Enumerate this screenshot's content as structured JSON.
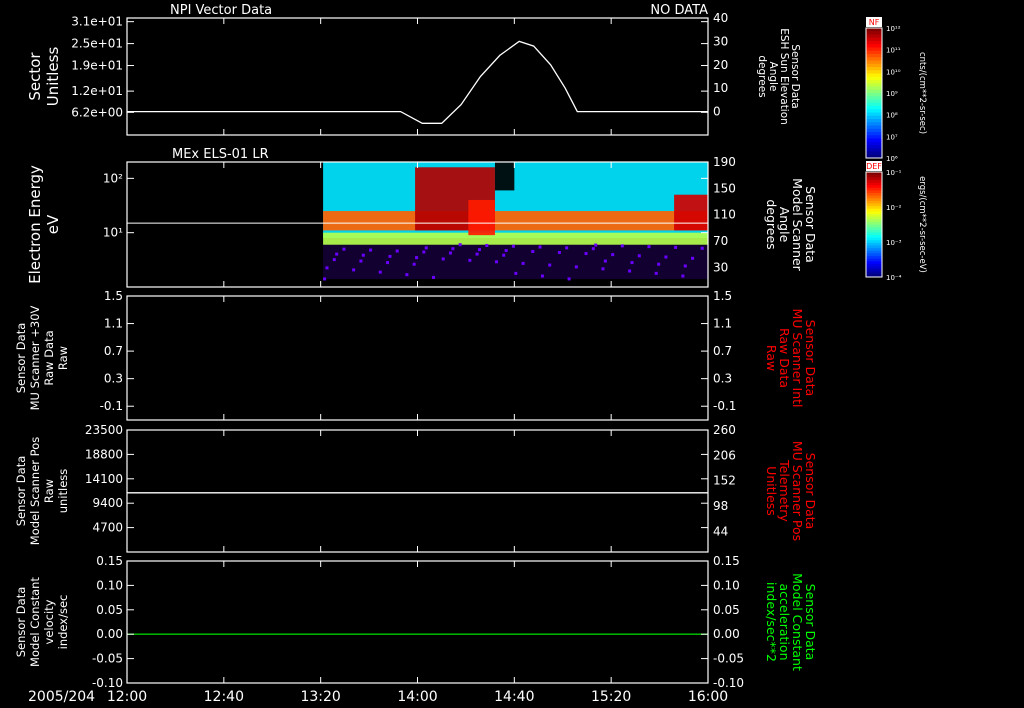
{
  "header": {
    "title": "NPI Vector Data",
    "status": "NO DATA"
  },
  "time_axis": {
    "date": "2005/204",
    "ticks": [
      "12:00",
      "12:40",
      "13:20",
      "14:00",
      "14:40",
      "15:20",
      "16:00"
    ],
    "tick_minutes": [
      720,
      760,
      800,
      840,
      880,
      920,
      960
    ],
    "range_minutes": [
      720,
      960
    ]
  },
  "colors": {
    "background": "#000000",
    "axis": "#ffffff",
    "trace": "#ffffff",
    "red_label": "#ff0000",
    "green_label": "#00ff00",
    "green_trace": "#00cc00"
  },
  "colorbars": [
    {
      "title": "NF",
      "label": "cnts/(cm**2-sr-sec)",
      "ticks": [
        "10¹²",
        "10¹¹",
        "10¹⁰",
        "10⁹",
        "10⁸",
        "10⁷",
        "10⁶"
      ]
    },
    {
      "title": "DEF",
      "label": "ergs/(cm**2-sr-sec-eV)",
      "ticks": [
        "10⁻¹",
        "10⁻²",
        "10⁻³",
        "10⁻⁴"
      ]
    }
  ],
  "chart_data": [
    {
      "type": "line",
      "left_label": [
        "Sector",
        "Unitless"
      ],
      "left_ticks": [
        "3.1e+01",
        "2.5e+01",
        "1.9e+01",
        "1.2e+01",
        "6.2e+00"
      ],
      "left_tick_values": [
        31,
        25,
        19,
        12,
        6.2
      ],
      "left_range": [
        0,
        32
      ],
      "right_label": [
        "Sensor Data",
        "ESH Sun Elevation",
        "Angle",
        "degrees"
      ],
      "right_label_color": "#ffffff",
      "right_ticks": [
        "40",
        "30",
        "20",
        "10",
        "0"
      ],
      "right_tick_values": [
        40,
        30,
        20,
        10,
        0
      ],
      "right_range": [
        -10,
        40
      ],
      "series": [
        {
          "axis": "right",
          "color": "#ffffff",
          "x": [
            720,
            810,
            833,
            842,
            850,
            858,
            866,
            874,
            882,
            888,
            895,
            901,
            906,
            911,
            918,
            960
          ],
          "y": [
            0,
            0,
            0,
            -5,
            -5,
            3,
            15,
            24,
            30,
            28,
            20,
            10,
            0,
            0,
            0,
            0
          ]
        }
      ]
    },
    {
      "type": "heatmap",
      "title": "MEx ELS-01 LR",
      "left_label": [
        "Electron Energy",
        "eV"
      ],
      "left_ticks": [
        "10²",
        "10¹"
      ],
      "left_tick_values": [
        100,
        10
      ],
      "left_log": true,
      "left_range": [
        1,
        200
      ],
      "right_label": [
        "Sensor Data",
        "Model Scanner",
        "Angle",
        "degrees"
      ],
      "right_label_color": "#ffffff",
      "right_ticks": [
        "190",
        "150",
        "110",
        "70",
        "30"
      ],
      "right_tick_values": [
        190,
        150,
        110,
        70,
        30
      ],
      "right_range": [
        0,
        190
      ],
      "data_start_minute": 801,
      "line_value": 15,
      "bands": [
        {
          "x": [
            801,
            960
          ],
          "y": [
            8,
            200
          ],
          "level": 0.35
        },
        {
          "x": [
            801,
            960
          ],
          "y": [
            11,
            25
          ],
          "level": 0.78
        },
        {
          "x": [
            801,
            960
          ],
          "y": [
            6,
            10
          ],
          "level": 0.55
        },
        {
          "x": [
            839,
            872
          ],
          "y": [
            11,
            160
          ],
          "level": 0.95
        },
        {
          "x": [
            861,
            872
          ],
          "y": [
            9,
            40
          ],
          "level": 0.85
        },
        {
          "x": [
            872,
            880
          ],
          "y": [
            60,
            200
          ],
          "level": 0.0
        },
        {
          "x": [
            946,
            960
          ],
          "y": [
            11,
            50
          ],
          "level": 0.92
        }
      ]
    },
    {
      "type": "line",
      "left_label": [
        "Sensor Data",
        "MU Scanner +30V",
        "Raw Data",
        "Raw"
      ],
      "left_ticks": [
        "1.5",
        "1.1",
        "0.7",
        "0.3",
        "-0.1"
      ],
      "left_tick_values": [
        1.5,
        1.1,
        0.7,
        0.3,
        -0.1
      ],
      "left_range": [
        -0.3,
        1.5
      ],
      "right_label": [
        "Sensor Data",
        "MU Scanner Intl",
        "Raw Data",
        "Raw"
      ],
      "right_label_color": "#ff0000",
      "right_ticks": [
        "1.5",
        "1.1",
        "0.7",
        "0.3",
        "-0.1"
      ],
      "right_tick_values": [
        1.5,
        1.1,
        0.7,
        0.3,
        -0.1
      ],
      "right_range": [
        -0.3,
        1.5
      ],
      "series": []
    },
    {
      "type": "line",
      "left_label": [
        "Sensor Data",
        "Model Scanner Pos",
        "Raw",
        "unitless"
      ],
      "left_ticks": [
        "23500",
        "18800",
        "14100",
        "9400",
        "4700"
      ],
      "left_tick_values": [
        23500,
        18800,
        14100,
        9400,
        4700
      ],
      "left_range": [
        0,
        23500
      ],
      "right_label": [
        "Sensor Data",
        "MU Scanner Pos",
        "Telemetry",
        "Unitless"
      ],
      "right_label_color": "#ff0000",
      "right_ticks": [
        "260",
        "206",
        "152",
        "98",
        "44"
      ],
      "right_tick_values": [
        260,
        206,
        152,
        98,
        44
      ],
      "right_range": [
        0,
        260
      ],
      "series": [
        {
          "axis": "left",
          "color": "#ffffff",
          "x": [
            720,
            960
          ],
          "y": [
            11400,
            11400
          ]
        }
      ]
    },
    {
      "type": "line",
      "left_label": [
        "Sensor Data",
        "Model Constant",
        "velocity",
        "index/sec"
      ],
      "left_ticks": [
        "0.15",
        "0.10",
        "0.05",
        "0.00",
        "-0.05",
        "-0.10"
      ],
      "left_tick_values": [
        0.15,
        0.1,
        0.05,
        0.0,
        -0.05,
        -0.1
      ],
      "left_range": [
        -0.1,
        0.15
      ],
      "right_label": [
        "Sensor Data",
        "Model Constant",
        "acceleration",
        "index/sec**2"
      ],
      "right_label_color": "#00ff00",
      "right_ticks": [
        "0.15",
        "0.10",
        "0.05",
        "0.00",
        "-0.05",
        "-0.10"
      ],
      "right_tick_values": [
        0.15,
        0.1,
        0.05,
        0.0,
        -0.05,
        -0.1
      ],
      "right_range": [
        -0.1,
        0.15
      ],
      "series": [
        {
          "axis": "left",
          "color": "#00cc00",
          "x": [
            720,
            960
          ],
          "y": [
            0,
            0
          ]
        }
      ]
    }
  ]
}
